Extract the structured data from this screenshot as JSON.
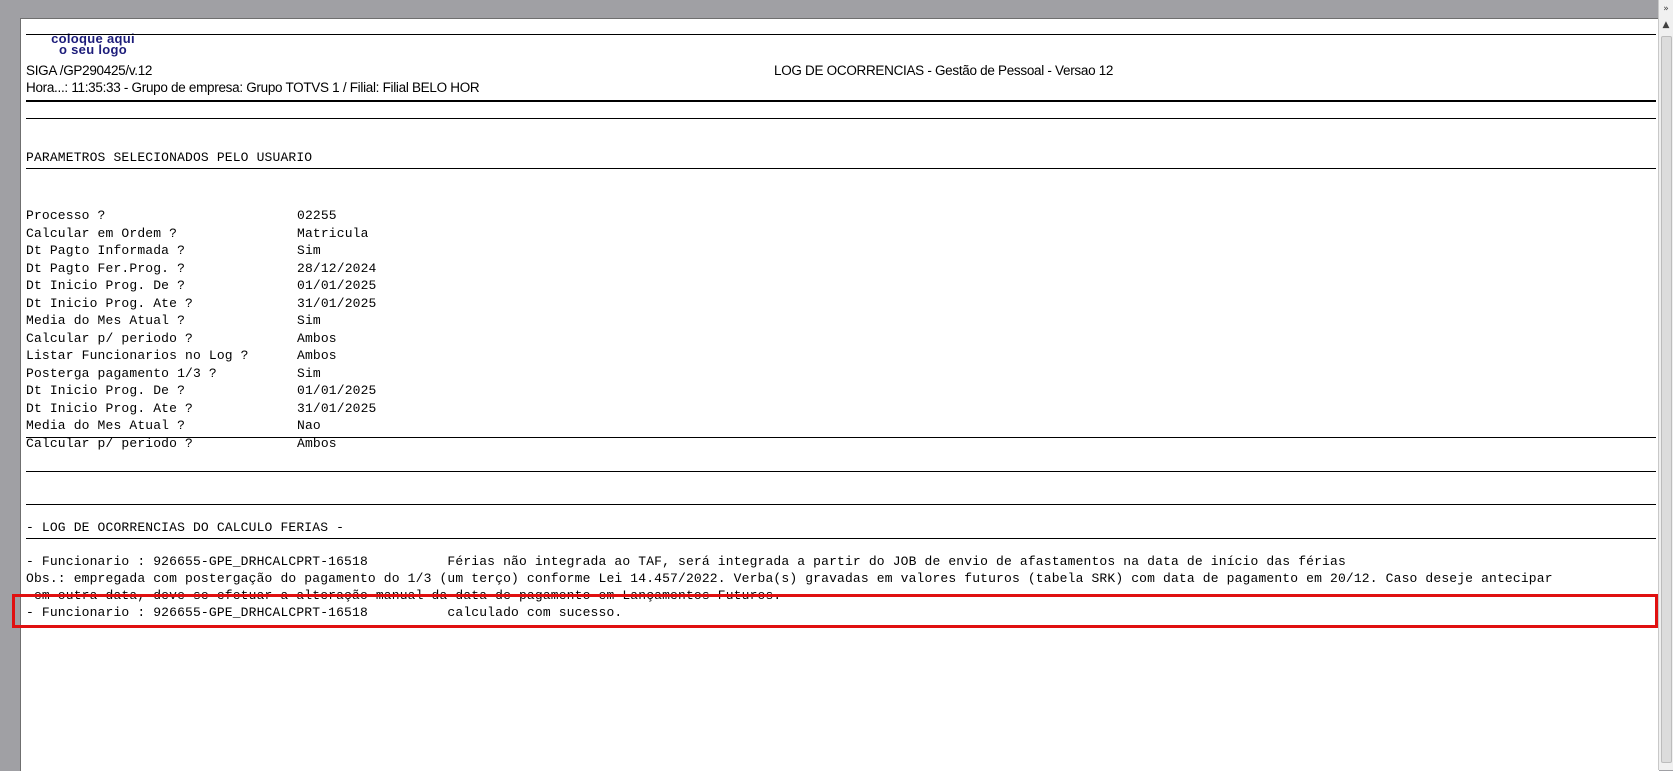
{
  "header": {
    "logo_line1": "coloque aqui",
    "logo_line2": "o seu logo",
    "program": "SIGA /GP290425/v.12",
    "report_title": "LOG DE OCORRENCIAS - Gestão de Pessoal - Versao 12",
    "info_line": "Hora...: 11:35:33 - Grupo de empresa: Grupo TOTVS 1 / Filial: Filial BELO HOR"
  },
  "params_section": {
    "title": "PARAMETROS SELECIONADOS PELO USUARIO",
    "rows": [
      {
        "label": "Processo ?",
        "value": "02255"
      },
      {
        "label": "Calcular em Ordem ?",
        "value": "Matricula"
      },
      {
        "label": "Dt Pagto Informada ?",
        "value": "Sim"
      },
      {
        "label": "Dt Pagto Fer.Prog. ?",
        "value": "28/12/2024"
      },
      {
        "label": "Dt Inicio Prog. De ?",
        "value": "01/01/2025"
      },
      {
        "label": "Dt Inicio Prog. Ate ?",
        "value": "31/01/2025"
      },
      {
        "label": "Media do Mes Atual ?",
        "value": "Sim"
      },
      {
        "label": "Calcular p/ periodo ?",
        "value": "Ambos"
      },
      {
        "label": "Listar Funcionarios no Log ?",
        "value": "Ambos"
      },
      {
        "label": "Posterga pagamento 1/3 ?",
        "value": "Sim"
      },
      {
        "label": "Dt Inicio Prog. De ?",
        "value": "01/01/2025"
      },
      {
        "label": "Dt Inicio Prog. Ate ?",
        "value": "31/01/2025"
      },
      {
        "label": "Media do Mes Atual ?",
        "value": "Nao"
      },
      {
        "label": "Calcular p/ periodo ?",
        "value": "Ambos"
      }
    ]
  },
  "log_section": {
    "title": "- LOG DE OCORRENCIAS DO CALCULO FERIAS -",
    "line1": "- Funcionario : 926655-GPE_DRHCALCPRT-16518          Férias não integrada ao TAF, será integrada a partir do JOB de envio de afastamentos na data de início das férias",
    "obs_line1": "Obs.: empregada com postergação do pagamento do 1/3 (um terço) conforme Lei 14.457/2022. Verba(s) gravadas em valores futuros (tabela SRK) com data de pagamento em 20/12. Caso deseje antecipar",
    "obs_line2": " em outra data, deve-se efetuar a alteração manual da data de pagamento em Lançamentos Futuros.",
    "line3": "- Funcionario : 926655-GPE_DRHCALCPRT-16518          calculado com sucesso."
  },
  "scrollbar": {
    "up_icon": "double-arrow",
    "up_arrow": "▲"
  },
  "colors": {
    "highlight": "#e01010",
    "background": "#a0a0a4"
  }
}
